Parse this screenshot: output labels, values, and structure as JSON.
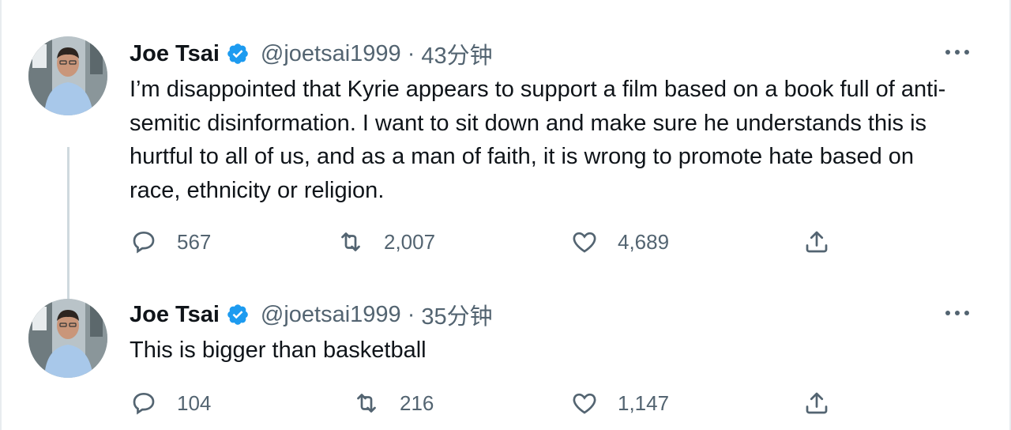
{
  "tweets": [
    {
      "author_name": "Joe Tsai",
      "handle": "@joetsai1999",
      "separator": "·",
      "time": "43分钟",
      "text": "I’m disappointed that Kyrie appears to support a film based on a book full of anti-semitic disinformation. I want to sit down and make sure he understands this is hurtful to all of us, and as a man of faith, it is wrong to promote hate based on race, ethnicity or religion.",
      "replies": "567",
      "retweets": "2,007",
      "likes": "4,689"
    },
    {
      "author_name": "Joe Tsai",
      "handle": "@joetsai1999",
      "separator": "·",
      "time": "35分钟",
      "text": "This is bigger than basketball",
      "replies": "104",
      "retweets": "216",
      "likes": "1,147"
    }
  ],
  "colors": {
    "verified_badge": "#1d9bf0",
    "secondary_text": "#536471",
    "primary_text": "#0f1419",
    "thread_line": "#cfd9de"
  },
  "icons": [
    "more-icon",
    "verified-icon",
    "reply-icon",
    "retweet-icon",
    "like-icon",
    "share-icon"
  ]
}
